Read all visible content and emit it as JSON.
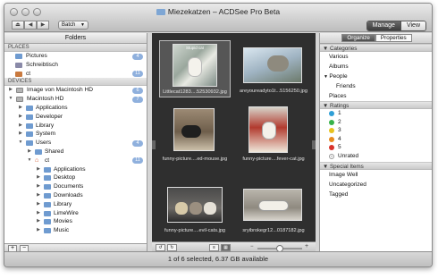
{
  "window": {
    "title": "Miezekatzen – ACDSee Pro Beta",
    "batch_label": "Batch",
    "modes": {
      "manage": "Manage",
      "view": "View"
    }
  },
  "folders_pane": {
    "header": "Folders",
    "places_header": "PLACES",
    "places": [
      {
        "label": "Pictures",
        "badge": "4",
        "icon": "folder-icon"
      },
      {
        "label": "Schreibtisch",
        "badge": "",
        "icon": "desktop-icon"
      },
      {
        "label": "ct",
        "badge": "11",
        "icon": "home-icon"
      }
    ],
    "devices_header": "DEVICES",
    "devices": [
      {
        "label": "Image von Macintosh HD",
        "badge": "6",
        "icon": "drive-icon"
      },
      {
        "label": "Macintosh HD",
        "badge": "7",
        "icon": "drive-icon"
      }
    ],
    "tree": [
      {
        "label": "Applications",
        "badge": ""
      },
      {
        "label": "Developer",
        "badge": ""
      },
      {
        "label": "Library",
        "badge": ""
      },
      {
        "label": "System",
        "badge": ""
      },
      {
        "label": "Users",
        "badge": "4"
      },
      {
        "label": "Shared",
        "badge": ""
      },
      {
        "label": "ct",
        "badge": "11"
      },
      {
        "label": "Applications",
        "badge": ""
      },
      {
        "label": "Desktop",
        "badge": ""
      },
      {
        "label": "Documents",
        "badge": ""
      },
      {
        "label": "Downloads",
        "badge": ""
      },
      {
        "label": "Library",
        "badge": ""
      },
      {
        "label": "LimeWire",
        "badge": ""
      },
      {
        "label": "Movies",
        "badge": ""
      },
      {
        "label": "Music",
        "badge": ""
      }
    ],
    "footer": {
      "add": "+",
      "remove": "−"
    }
  },
  "thumbnails": [
    {
      "caption": "Littlecat1283....52530932.jpg",
      "selected": true,
      "overlay_text": "Stupid cat"
    },
    {
      "caption": "areyoureadyto1t...5156250.jpg",
      "selected": false,
      "overlay_text": ""
    },
    {
      "caption": "funny-picture....ed-mouse.jpg",
      "selected": false,
      "overlay_text": ""
    },
    {
      "caption": "funny-picture....fever-cat.jpg",
      "selected": false,
      "overlay_text": ""
    },
    {
      "caption": "funny-picture....evil-cats.jpg",
      "selected": false,
      "overlay_text": ""
    },
    {
      "caption": "sryibrokegr12...0187182.jpg",
      "selected": false,
      "overlay_text": ""
    }
  ],
  "properties_pane": {
    "tabs": {
      "organize": "Organize",
      "properties": "Properties"
    },
    "categories_header": "Categories",
    "categories": [
      "Various",
      "Albums",
      "People",
      "Friends",
      "Places"
    ],
    "ratings_header": "Ratings",
    "ratings": [
      {
        "label": "1",
        "color": "#2f9fd6"
      },
      {
        "label": "2",
        "color": "#37b24a"
      },
      {
        "label": "3",
        "color": "#e7c21e"
      },
      {
        "label": "4",
        "color": "#e88a1e"
      },
      {
        "label": "5",
        "color": "#d8322a"
      },
      {
        "label": "Unrated",
        "color": "#cccccc"
      }
    ],
    "special_header": "Special Items",
    "special": [
      "Image Well",
      "Uncategorized",
      "Tagged"
    ]
  },
  "status": {
    "text": "1 of 6 selected, 6.37 GB available"
  },
  "colors": {
    "accent_badge": "#8fb0dd",
    "selection_bg": "#565656",
    "grid_bg": "#2f2f2f"
  }
}
